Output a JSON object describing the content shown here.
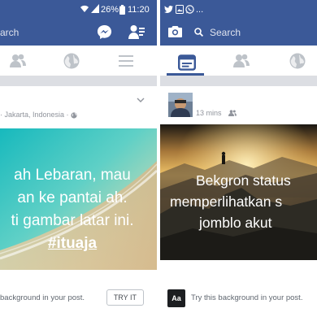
{
  "left_phone": {
    "status": {
      "battery": "26%",
      "time": "11:20"
    },
    "search": {
      "placeholder": "arch"
    },
    "post": {
      "location": "Jakarta, Indonesia",
      "lines": [
        "ah Lebaran, mau",
        "an ke pantai ah.",
        "ti gambar latar ini.",
        "#ituaja"
      ],
      "hint": "background in your post.",
      "try_label": "TRY IT"
    }
  },
  "right_phone": {
    "status": {
      "dots": "..."
    },
    "search": {
      "placeholder": "Search"
    },
    "post": {
      "time": "13 mins",
      "lines": [
        "Bekgron status",
        "memperlihatkan s",
        "jomblo akut"
      ],
      "aa_label": "Aa",
      "hint": "Try this background in your post."
    }
  }
}
